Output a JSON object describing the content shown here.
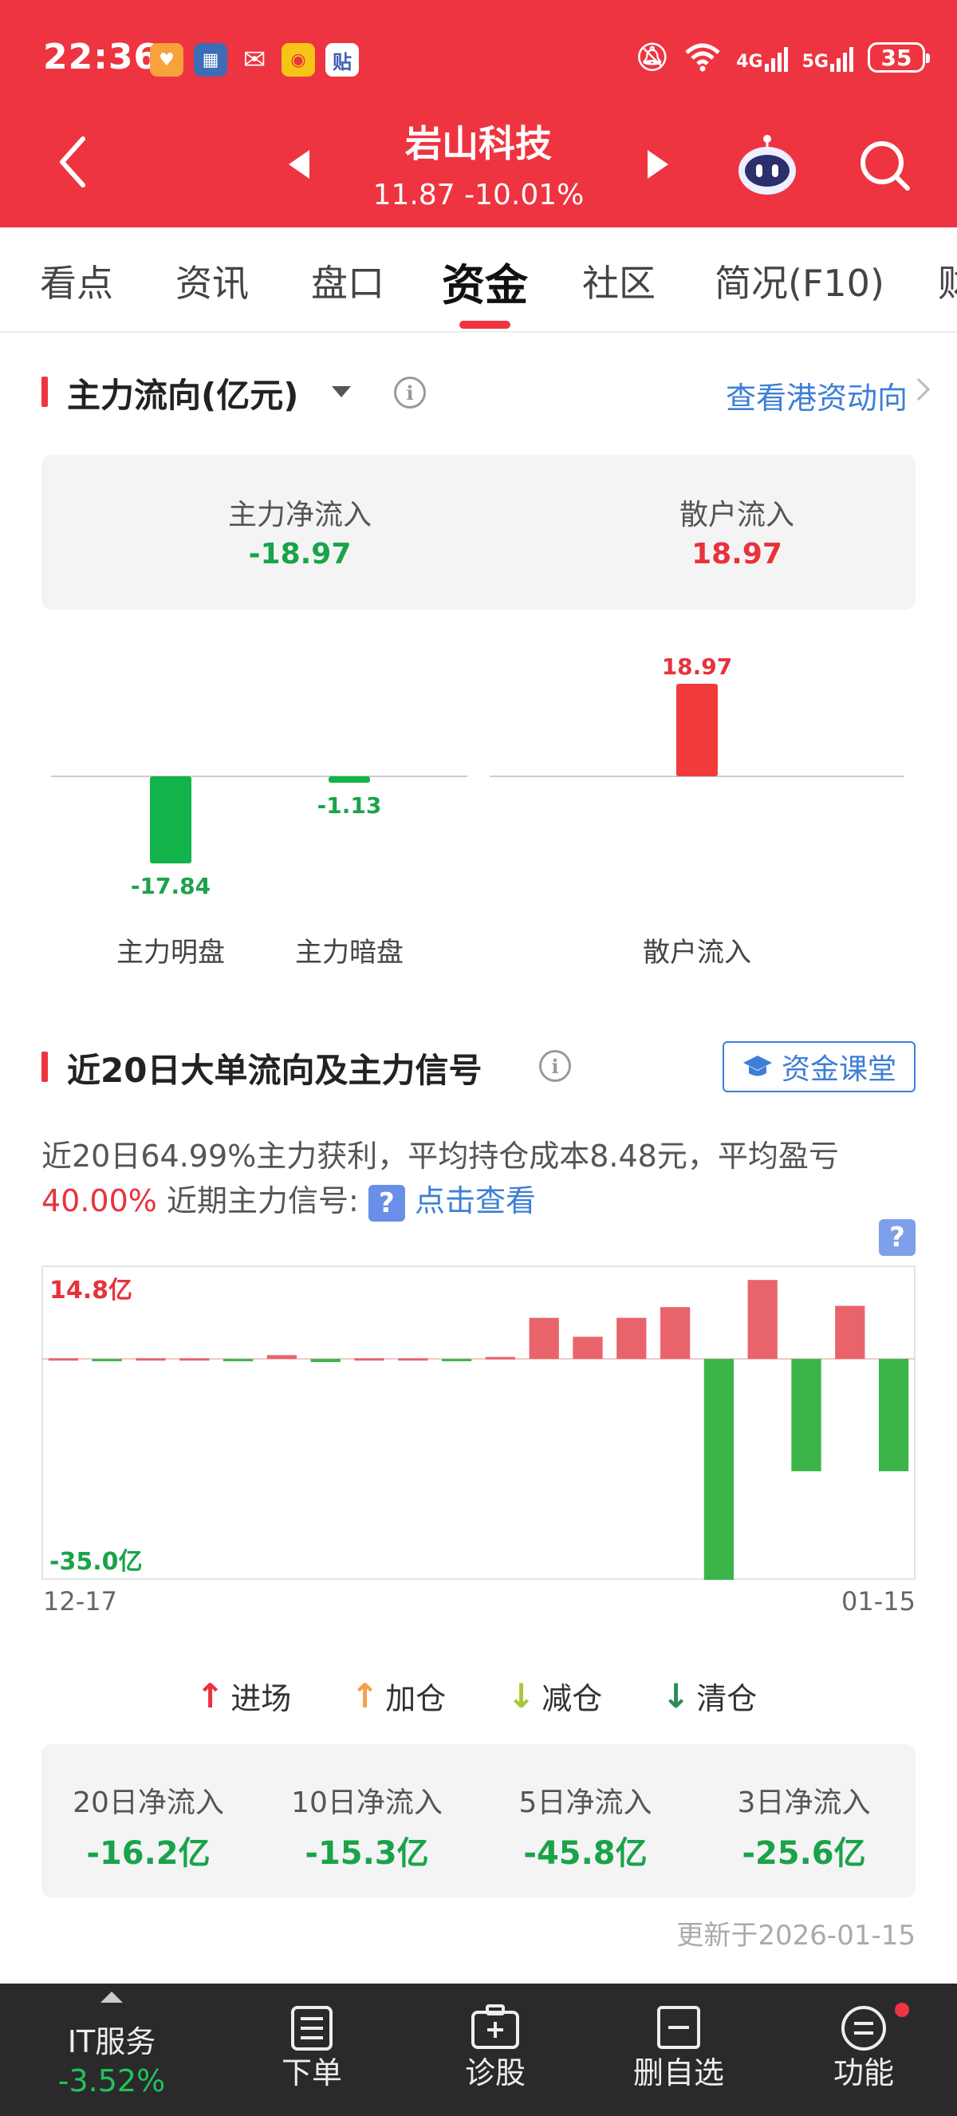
{
  "status_bar": {
    "time": "22:36",
    "network_4g": "4G",
    "network_5g": "5G",
    "battery": "35"
  },
  "header": {
    "stock_name": "岩山科技",
    "price_change": "11.87  -10.01%"
  },
  "tabs": [
    "看点",
    "资讯",
    "盘口",
    "资金",
    "社区",
    "简况(F10)",
    "财"
  ],
  "active_tab": "资金",
  "main_flow": {
    "title": "主力流向(亿元)",
    "link": "查看港资动向",
    "net_inflow_label": "主力净流入",
    "net_inflow_value": "-18.97",
    "retail_label": "散户流入",
    "retail_value": "18.97"
  },
  "chart_data": [
    {
      "type": "bar",
      "categories": [
        "主力明盘",
        "主力暗盘",
        "散户流入"
      ],
      "values": [
        -17.84,
        -1.13,
        18.97
      ],
      "data_labels": [
        "-17.84",
        "-1.13",
        "18.97"
      ],
      "colors": {
        "positive": "#f23a3a",
        "negative": "#12b34a"
      }
    },
    {
      "type": "bar",
      "title": "近20日大单流向及主力信号",
      "x_start": "12-17",
      "x_end": "01-15",
      "y_max_label": "14.8亿",
      "y_min_label": "-35.0亿",
      "ylim": [
        -35.0,
        14.8
      ],
      "values": [
        0.1,
        -0.3,
        0.1,
        0.1,
        -0.2,
        0.6,
        -0.5,
        0.1,
        0.1,
        -0.1,
        0.3,
        6.5,
        3.5,
        6.5,
        8.2,
        -35.0,
        12.5,
        -17.8,
        8.4,
        -17.8
      ],
      "colors": {
        "positive": "#e8646a",
        "negative": "#3bb54a"
      }
    }
  ],
  "signals": {
    "title": "近20日大单流向及主力信号",
    "course_button": "资金课堂",
    "desc_line1": "近20日64.99%主力获利，平均持仓成本8.48元，平均盈亏",
    "desc_pct": "40.00%",
    "desc_signal_label": "近期主力信号:",
    "desc_link": "点击查看",
    "help_badge": "?"
  },
  "legend": [
    {
      "label": "进场",
      "arrow": "↑",
      "color": "#e8323c"
    },
    {
      "label": "加仓",
      "arrow": "↑",
      "color": "#f4a04a"
    },
    {
      "label": "减仓",
      "arrow": "↓",
      "color": "#a6c83a"
    },
    {
      "label": "清仓",
      "arrow": "↓",
      "color": "#2e8b57"
    }
  ],
  "net_flows": [
    {
      "label": "20日净流入",
      "value": "-16.2亿"
    },
    {
      "label": "10日净流入",
      "value": "-15.3亿"
    },
    {
      "label": "5日净流入",
      "value": "-45.8亿"
    },
    {
      "label": "3日净流入",
      "value": "-25.6亿"
    }
  ],
  "update_time": "更新于2026-01-15",
  "bottom_bar": {
    "sector_name": "IT服务",
    "sector_change": "-3.52%",
    "items": [
      "下单",
      "诊股",
      "删自选",
      "功能"
    ]
  }
}
